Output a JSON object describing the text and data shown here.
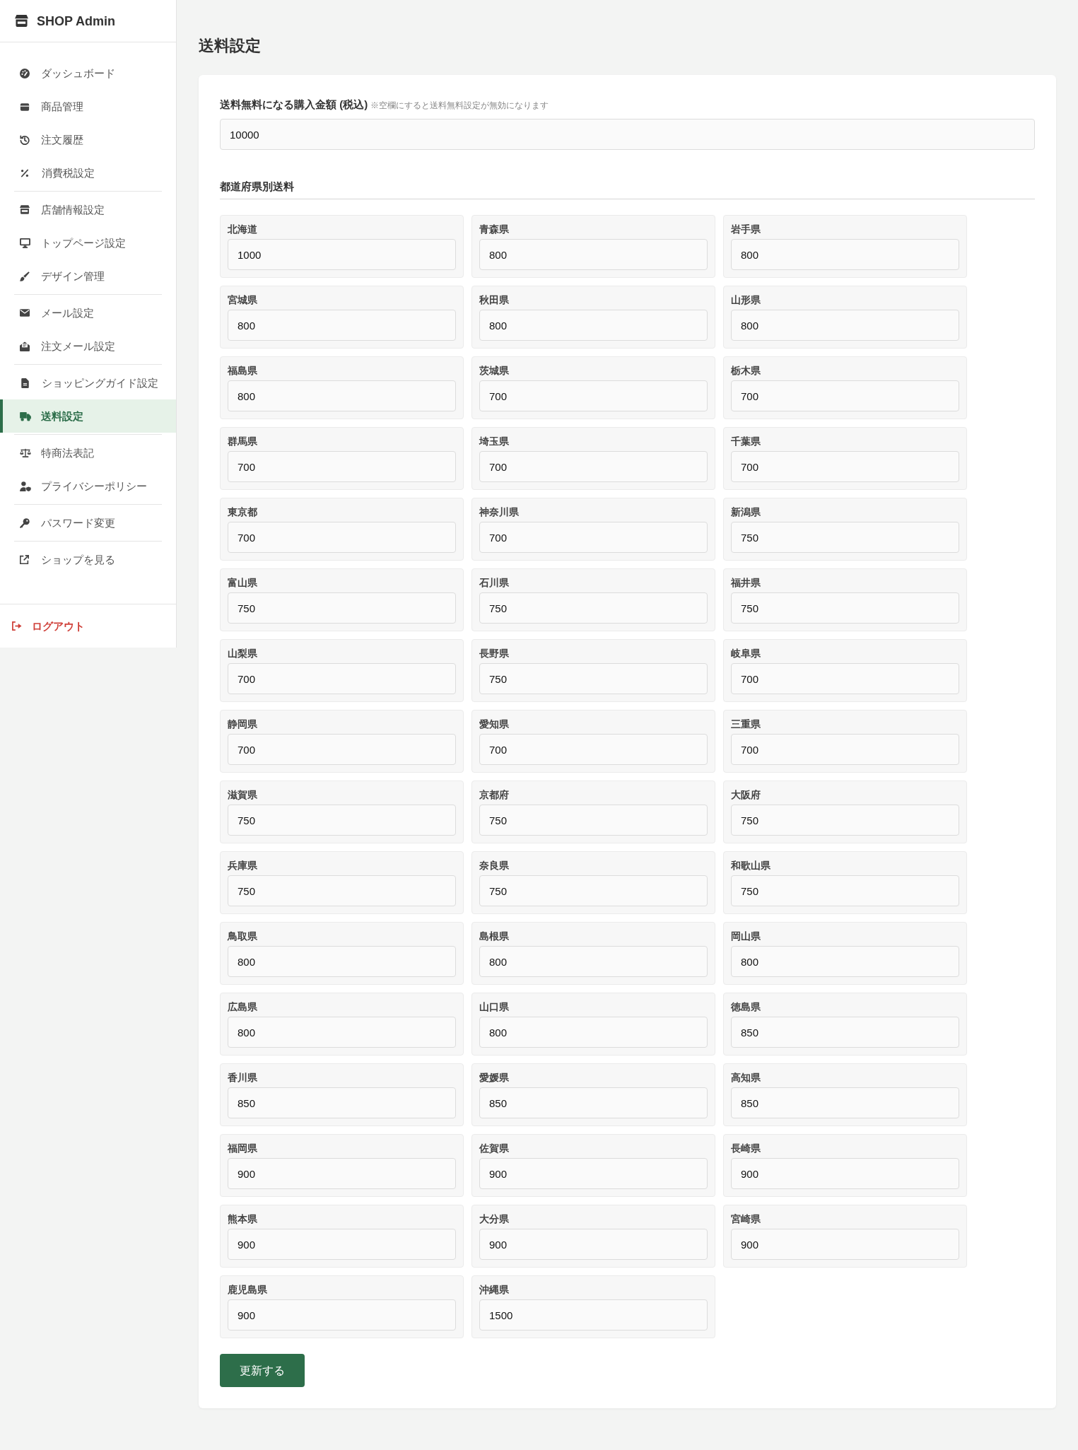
{
  "sidebar": {
    "brand": "SHOP Admin",
    "groups": [
      {
        "items": [
          {
            "label": "ダッシュボード",
            "selected": false
          },
          {
            "label": "商品管理",
            "selected": false
          },
          {
            "label": "注文履歴",
            "selected": false
          },
          {
            "label": "消費税設定",
            "selected": false
          }
        ]
      },
      {
        "items": [
          {
            "label": "店舗情報設定",
            "selected": false
          },
          {
            "label": "トップページ設定",
            "selected": false
          },
          {
            "label": "デザイン管理",
            "selected": false
          }
        ]
      },
      {
        "items": [
          {
            "label": "メール設定",
            "selected": false
          },
          {
            "label": "注文メール設定",
            "selected": false
          }
        ]
      },
      {
        "items": [
          {
            "label": "ショッピングガイド設定",
            "selected": false
          },
          {
            "label": "送料設定",
            "selected": true
          }
        ]
      },
      {
        "items": [
          {
            "label": "特商法表記",
            "selected": false
          },
          {
            "label": "プライバシーポリシー",
            "selected": false
          }
        ]
      },
      {
        "items": [
          {
            "label": "パスワード変更",
            "selected": false
          }
        ]
      },
      {
        "items": [
          {
            "label": "ショップを見る",
            "selected": false
          }
        ]
      }
    ],
    "logout": "ログアウト"
  },
  "page_title": "送料設定",
  "free_shipping": {
    "label": "送料無料になる購入金額 (税込)",
    "note": "※空欄にすると送料無料設定が無効になります",
    "value": "10000"
  },
  "prefecture_fees": {
    "heading": "都道府県別送料",
    "items": [
      {
        "name": "北海道",
        "value": "1000"
      },
      {
        "name": "青森県",
        "value": "800"
      },
      {
        "name": "岩手県",
        "value": "800"
      },
      {
        "name": "宮城県",
        "value": "800"
      },
      {
        "name": "秋田県",
        "value": "800"
      },
      {
        "name": "山形県",
        "value": "800"
      },
      {
        "name": "福島県",
        "value": "800"
      },
      {
        "name": "茨城県",
        "value": "700"
      },
      {
        "name": "栃木県",
        "value": "700"
      },
      {
        "name": "群馬県",
        "value": "700"
      },
      {
        "name": "埼玉県",
        "value": "700"
      },
      {
        "name": "千葉県",
        "value": "700"
      },
      {
        "name": "東京都",
        "value": "700"
      },
      {
        "name": "神奈川県",
        "value": "700"
      },
      {
        "name": "新潟県",
        "value": "750"
      },
      {
        "name": "富山県",
        "value": "750"
      },
      {
        "name": "石川県",
        "value": "750"
      },
      {
        "name": "福井県",
        "value": "750"
      },
      {
        "name": "山梨県",
        "value": "700"
      },
      {
        "name": "長野県",
        "value": "750"
      },
      {
        "name": "岐阜県",
        "value": "700"
      },
      {
        "name": "静岡県",
        "value": "700"
      },
      {
        "name": "愛知県",
        "value": "700"
      },
      {
        "name": "三重県",
        "value": "700"
      },
      {
        "name": "滋賀県",
        "value": "750"
      },
      {
        "name": "京都府",
        "value": "750"
      },
      {
        "name": "大阪府",
        "value": "750"
      },
      {
        "name": "兵庫県",
        "value": "750"
      },
      {
        "name": "奈良県",
        "value": "750"
      },
      {
        "name": "和歌山県",
        "value": "750"
      },
      {
        "name": "鳥取県",
        "value": "800"
      },
      {
        "name": "島根県",
        "value": "800"
      },
      {
        "name": "岡山県",
        "value": "800"
      },
      {
        "name": "広島県",
        "value": "800"
      },
      {
        "name": "山口県",
        "value": "800"
      },
      {
        "name": "徳島県",
        "value": "850"
      },
      {
        "name": "香川県",
        "value": "850"
      },
      {
        "name": "愛媛県",
        "value": "850"
      },
      {
        "name": "高知県",
        "value": "850"
      },
      {
        "name": "福岡県",
        "value": "900"
      },
      {
        "name": "佐賀県",
        "value": "900"
      },
      {
        "name": "長崎県",
        "value": "900"
      },
      {
        "name": "熊本県",
        "value": "900"
      },
      {
        "name": "大分県",
        "value": "900"
      },
      {
        "name": "宮崎県",
        "value": "900"
      },
      {
        "name": "鹿児島県",
        "value": "900"
      },
      {
        "name": "沖縄県",
        "value": "1500"
      }
    ]
  },
  "submit_button": "更新する"
}
